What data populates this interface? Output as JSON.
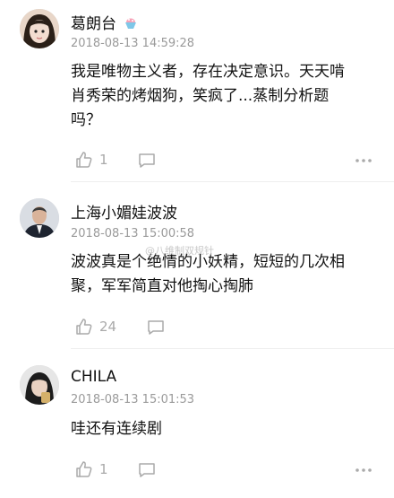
{
  "comments": [
    {
      "name": "葛朗台",
      "time": "2018-08-13 14:59:28",
      "line1": "我是唯物主义者，存在决定意识。天天啃",
      "line2": "肖秀荣的烤烟狗，笑疯了...蒸制分析题",
      "line3": "吗？",
      "likes": "1"
    },
    {
      "name": "上海小媚娃波波",
      "time": "2018-08-13 15:00:58",
      "line1": "波波真是个绝情的小妖精，短短的几次相",
      "line2": "聚，军军简直对他掏心掏肺",
      "likes": "24"
    },
    {
      "name": "CHILA",
      "time": "2018-08-13 15:01:53",
      "line1": "哇还有连续剧",
      "likes": "1"
    }
  ],
  "watermark": "@八维制双规针",
  "icons": {
    "like": "thumbs-up-icon",
    "reply": "speech-bubble-icon",
    "more": "more-dots-icon",
    "badge": "shaved-ice-icon"
  },
  "colors": {
    "text": "#111111",
    "meta": "#9a9a9a",
    "icon": "#aaaaaa"
  }
}
